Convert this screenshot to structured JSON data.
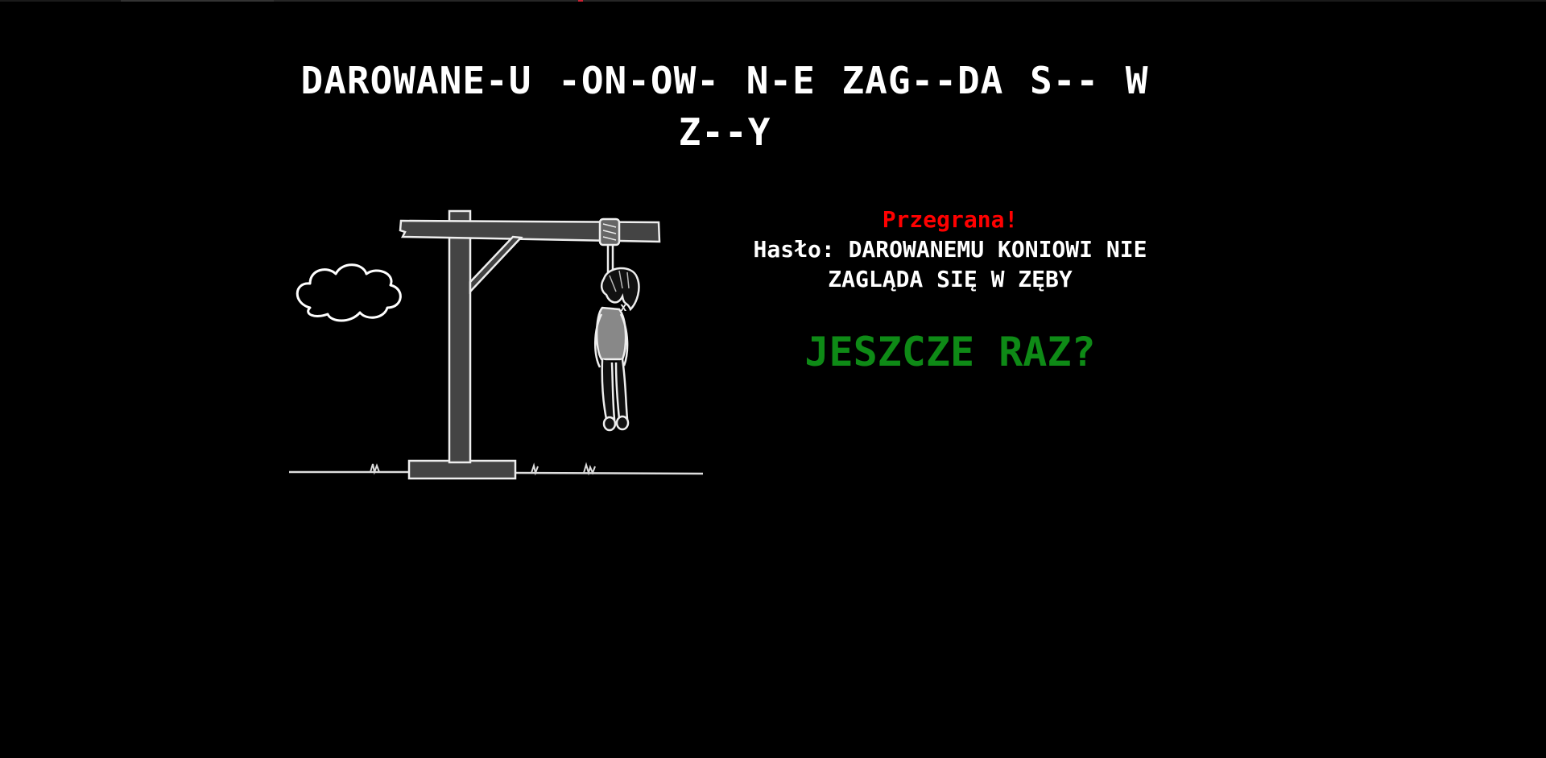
{
  "game": {
    "puzzle_display": "DAROWANE-U -ON-OW- N-E ZAG--DA S-- W Z--Y",
    "status": "Przegrana!",
    "answer_label": "Hasło:",
    "answer_text": "DAROWANEMU KONIOWI NIE ZAGLĄDA SIĘ W ZĘBY",
    "retry_label": "JESZCZE RAZ?"
  },
  "colors": {
    "background": "#000000",
    "status": "#ff0000",
    "retry": "#0e8a16",
    "text": "#ffffff"
  },
  "icons": [
    "cloud-icon",
    "gallows-icon",
    "hanged-figure-icon"
  ]
}
